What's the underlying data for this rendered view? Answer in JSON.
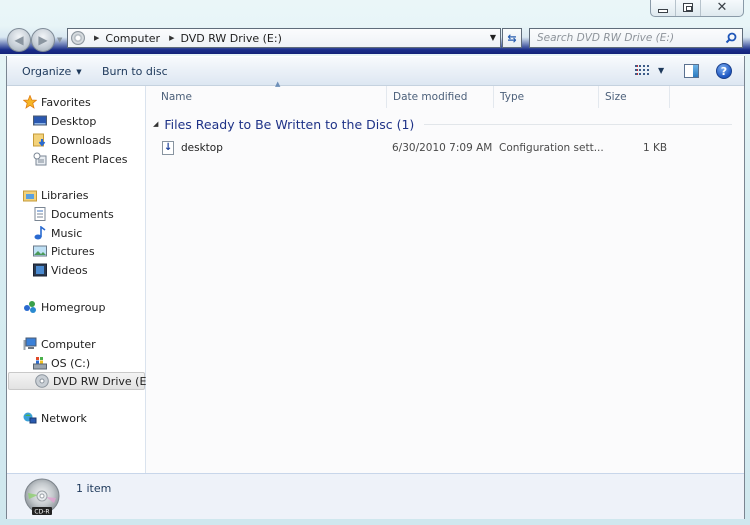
{
  "window": {
    "caption_buttons": {
      "minimize": "minimize",
      "maximize": "restore",
      "close": "close"
    }
  },
  "navigation": {
    "back_icon": "arrow-left-icon",
    "forward_icon": "arrow-right-icon",
    "breadcrumbs": [
      "Computer",
      "DVD RW Drive (E:)"
    ],
    "refresh_icon": "refresh-icon",
    "search_placeholder": "Search DVD RW Drive (E:)"
  },
  "toolbar": {
    "organize_label": "Organize",
    "burn_label": "Burn to disc",
    "views_icon": "views-icon",
    "preview_icon": "preview-pane-icon",
    "help_label": "?"
  },
  "sidebar": {
    "favorites": {
      "label": "Favorites",
      "items": [
        {
          "label": "Desktop",
          "icon": "desktop-icon"
        },
        {
          "label": "Downloads",
          "icon": "downloads-icon"
        },
        {
          "label": "Recent Places",
          "icon": "recent-places-icon"
        }
      ]
    },
    "libraries": {
      "label": "Libraries",
      "items": [
        {
          "label": "Documents",
          "icon": "documents-icon"
        },
        {
          "label": "Music",
          "icon": "music-icon"
        },
        {
          "label": "Pictures",
          "icon": "pictures-icon"
        },
        {
          "label": "Videos",
          "icon": "videos-icon"
        }
      ]
    },
    "homegroup": {
      "label": "Homegroup"
    },
    "computer": {
      "label": "Computer",
      "items": [
        {
          "label": "OS (C:)",
          "icon": "hard-drive-icon"
        },
        {
          "label": "DVD RW Drive (E:)",
          "icon": "dvd-drive-icon",
          "selected": true
        }
      ]
    },
    "network": {
      "label": "Network"
    }
  },
  "content": {
    "columns": [
      "Name",
      "Date modified",
      "Type",
      "Size"
    ],
    "group": {
      "title": "Files Ready to Be Written to the Disc (1)"
    },
    "files": [
      {
        "name": "desktop",
        "date_modified": "6/30/2010 7:09 AM",
        "type": "Configuration sett...",
        "size": "1 KB"
      }
    ]
  },
  "statusbar": {
    "item_count": "1 item",
    "disc_label": "CD-R"
  }
}
